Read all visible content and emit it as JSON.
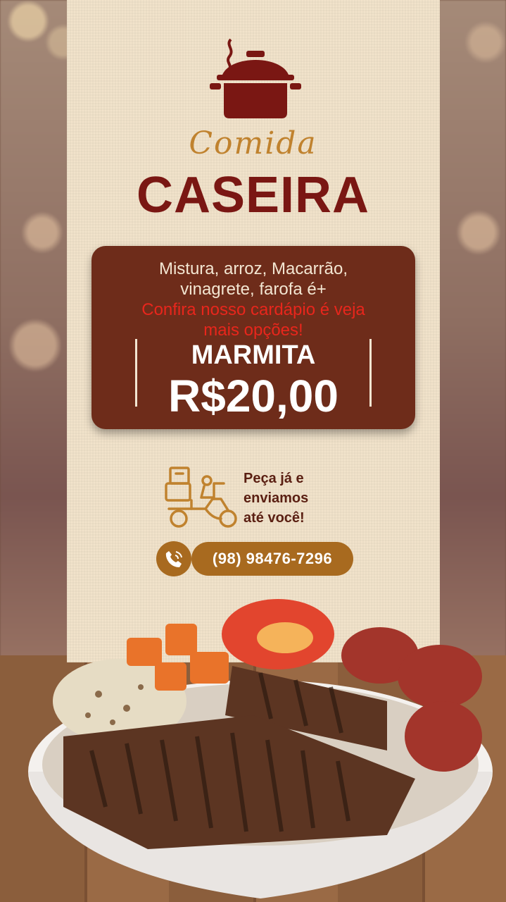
{
  "brand": {
    "script": "Comida",
    "title": "CASEIRA",
    "icon": "cooking-pot-icon"
  },
  "offer": {
    "line1": "Mistura, arroz, Macarrão,",
    "line2": "vinagrete, farofa é+",
    "highlight1": "Confira nosso cardápio é veja",
    "highlight2": "mais opções!",
    "label": "MARMITA",
    "price": "R$20,00"
  },
  "delivery": {
    "icon": "delivery-scooter-icon",
    "line1": "Peça já e",
    "line2": "enviamos",
    "line3": "até você!"
  },
  "contact": {
    "icon": "phone-icon",
    "phone": "(98) 98476-7296"
  },
  "colors": {
    "brand_red": "#7a1713",
    "gold": "#c0822e",
    "card_brown": "#6e2c1a",
    "highlight_red": "#e8261c"
  }
}
